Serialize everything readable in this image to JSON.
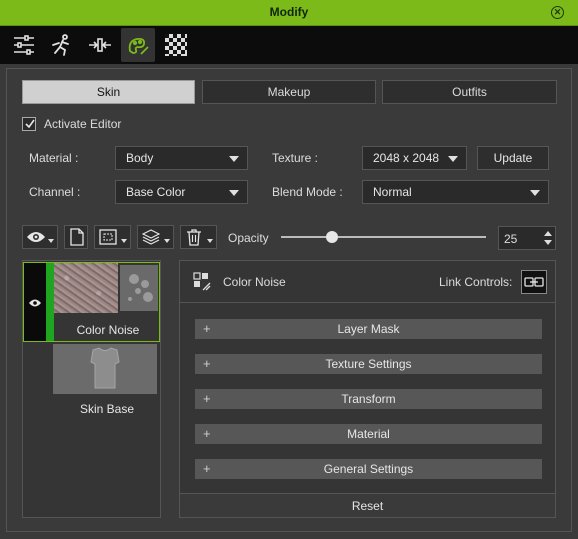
{
  "window": {
    "title": "Modify"
  },
  "toolbar": {
    "tools": [
      "sliders-icon",
      "pose-icon",
      "transform-icon",
      "appearance-editor-icon",
      "checker-icon"
    ],
    "active_index": 3
  },
  "tabs": [
    {
      "label": "Skin",
      "active": true
    },
    {
      "label": "Makeup",
      "active": false
    },
    {
      "label": "Outfits",
      "active": false
    }
  ],
  "activate_editor": {
    "label": "Activate Editor",
    "checked": true
  },
  "fields": {
    "material_label": "Material :",
    "material_value": "Body",
    "texture_label": "Texture :",
    "texture_value": "2048 x 2048",
    "update_label": "Update",
    "channel_label": "Channel :",
    "channel_value": "Base Color",
    "blend_label": "Blend Mode :",
    "blend_value": "Normal"
  },
  "opacity": {
    "label": "Opacity",
    "value": "25",
    "fraction": 0.25
  },
  "layers": [
    {
      "name": "Color Noise",
      "selected": true,
      "visible": true
    },
    {
      "name": "Skin Base",
      "selected": false,
      "visible": false
    }
  ],
  "editor": {
    "layer_name": "Color Noise",
    "link_label": "Link Controls:",
    "sections": [
      "Layer Mask",
      "Texture Settings",
      "Transform",
      "Material",
      "General Settings"
    ],
    "reset_label": "Reset"
  },
  "colors": {
    "accent": "#7cba1a",
    "layer_marker": "#1fa51f"
  }
}
